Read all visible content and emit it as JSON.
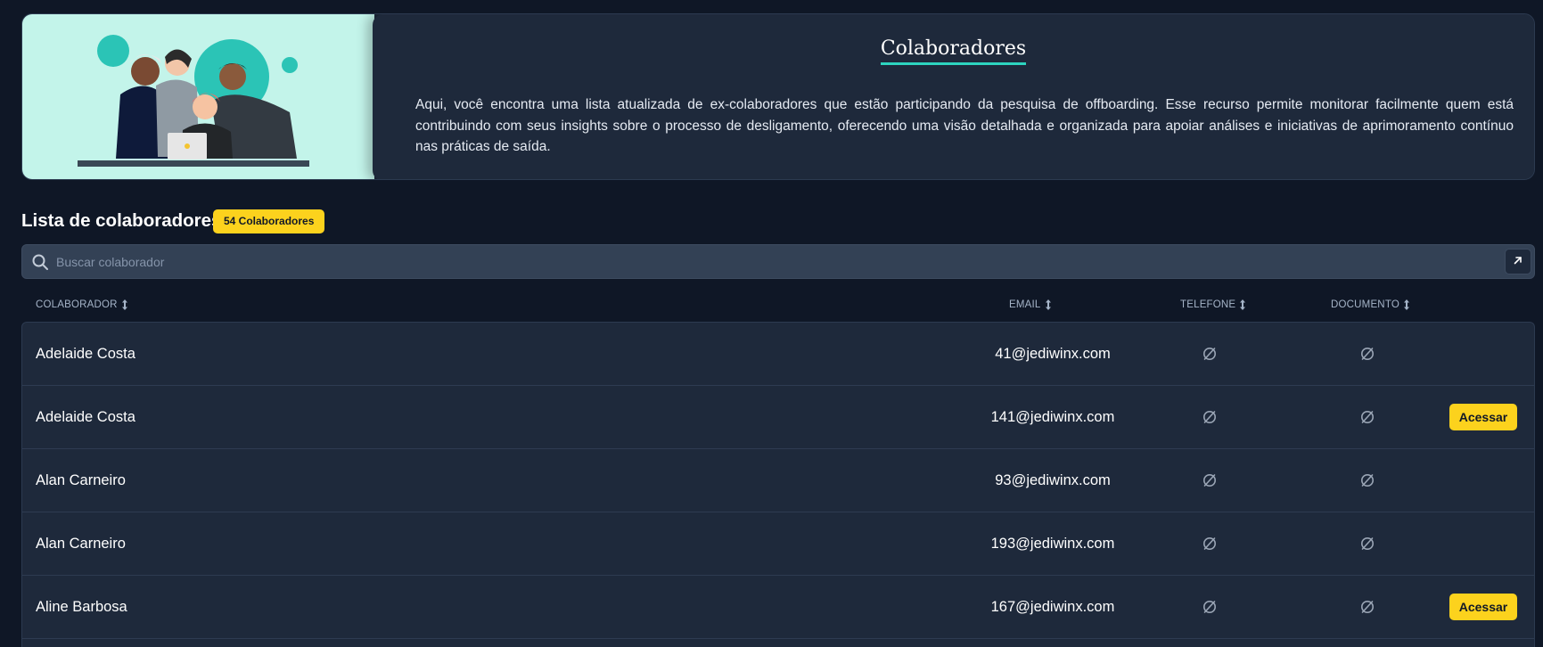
{
  "hero": {
    "title": "Colaboradores",
    "description": "Aqui, você encontra uma lista atualizada de ex-colaboradores que estão participando da pesquisa de offboarding. Esse recurso permite monitorar facilmente quem está contribuindo com seus insights sobre o processo de desligamento, oferecendo uma visão detalhada e organizada para apoiar análises e iniciativas de aprimoramento contínuo nas práticas de saída.",
    "accent_color": "#2dd4bf",
    "illustration_bg": "#c3f4ea"
  },
  "section": {
    "title": "Lista de colaboradores",
    "count_badge": "54 Colaboradores",
    "badge_color": "#fcd21d"
  },
  "search": {
    "placeholder": "Buscar colaborador",
    "value": "",
    "icon": "search-icon",
    "expand_icon": "arrow-up-right-icon"
  },
  "table": {
    "columns": {
      "collaborator": "COLABORADOR",
      "email": "EMAIL",
      "phone": "TELEFONE",
      "document": "DOCUMENTO"
    },
    "empty_icon": "empty-set-icon",
    "action_label": "Acessar",
    "rows": [
      {
        "name": "Adelaide Costa",
        "email": "41@jediwinx.com",
        "phone": "",
        "document": "",
        "has_action": false
      },
      {
        "name": "Adelaide Costa",
        "email": "141@jediwinx.com",
        "phone": "",
        "document": "",
        "has_action": true
      },
      {
        "name": "Alan Carneiro",
        "email": "93@jediwinx.com",
        "phone": "",
        "document": "",
        "has_action": false
      },
      {
        "name": "Alan Carneiro",
        "email": "193@jediwinx.com",
        "phone": "",
        "document": "",
        "has_action": false
      },
      {
        "name": "Aline Barbosa",
        "email": "167@jediwinx.com",
        "phone": "",
        "document": "",
        "has_action": true
      }
    ]
  },
  "theme": {
    "background": "#0f1726",
    "card": "#1e293b",
    "search_bg": "#334155"
  }
}
